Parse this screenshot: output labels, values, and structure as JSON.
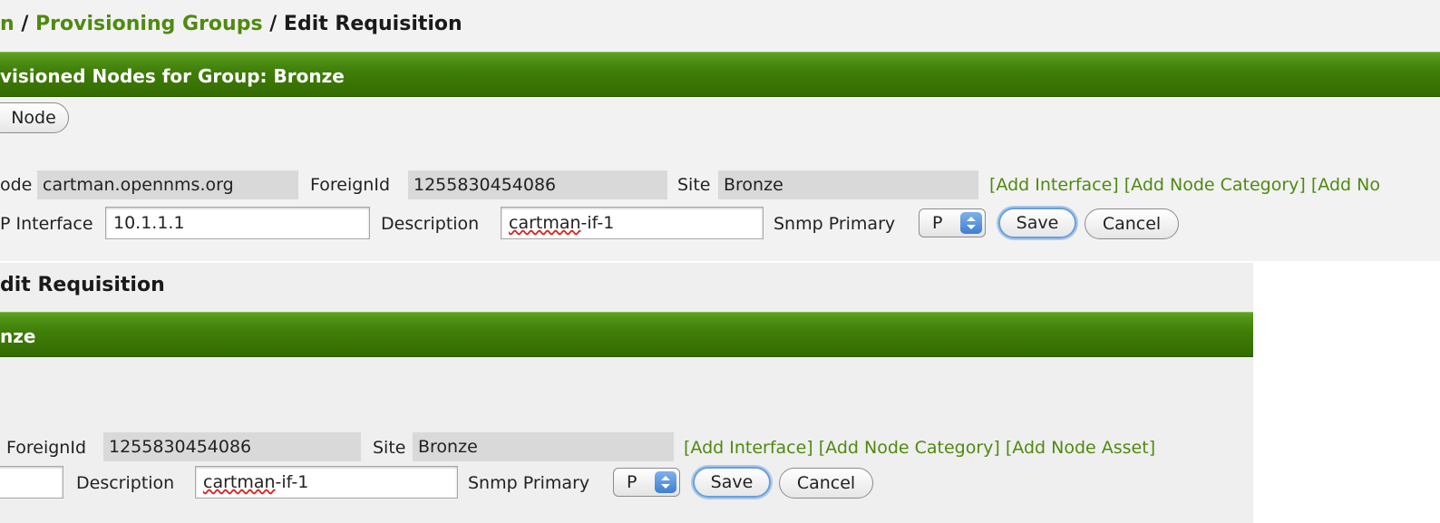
{
  "top": {
    "breadcrumb": {
      "prefix": "n",
      "sep1": " / ",
      "provisioning_groups": "Provisioning Groups",
      "sep2": " / ",
      "current": "Edit Requisition"
    },
    "header_bar": "visioned Nodes for Group: Bronze",
    "add_node_button": "Node",
    "node_row": {
      "node_label": "ode",
      "node_value": "cartman.opennms.org",
      "foreign_id_label": "ForeignId",
      "foreign_id_value": "1255830454086",
      "site_label": "Site",
      "site_value": "Bronze",
      "add_interface": "[Add Interface]",
      "add_node_category": "[Add Node Category]",
      "add_node_asset": "[Add No"
    },
    "interface_row": {
      "ip_label": "P Interface",
      "ip_value": "10.1.1.1",
      "description_label": "Description",
      "description_value_a": "cartman",
      "description_value_b": "-if-1",
      "snmp_primary_label": "Snmp Primary",
      "snmp_primary_value": "P",
      "save": "Save",
      "cancel": "Cancel"
    }
  },
  "bottom": {
    "title": "dit Requisition",
    "header_bar": "nze",
    "node_row": {
      "foreign_id_label": "ForeignId",
      "foreign_id_value": "1255830454086",
      "site_label": "Site",
      "site_value": "Bronze",
      "add_interface": "[Add Interface]",
      "add_node_category": "[Add Node Category]",
      "add_node_asset": "[Add Node Asset]"
    },
    "interface_row": {
      "description_label": "Description",
      "description_value_a": "cartman",
      "description_value_b": "-if-1",
      "snmp_primary_label": "Snmp Primary",
      "snmp_primary_value": "P",
      "save": "Save",
      "cancel": "Cancel"
    }
  },
  "colors": {
    "link_green": "#4f8a10",
    "header_bar_green": "#3f7d08",
    "panel_bg": "#f2f2f2",
    "readonly_bg": "#d9d9d9"
  },
  "icons": {
    "select_arrows": "up-down-chevron-icon"
  }
}
